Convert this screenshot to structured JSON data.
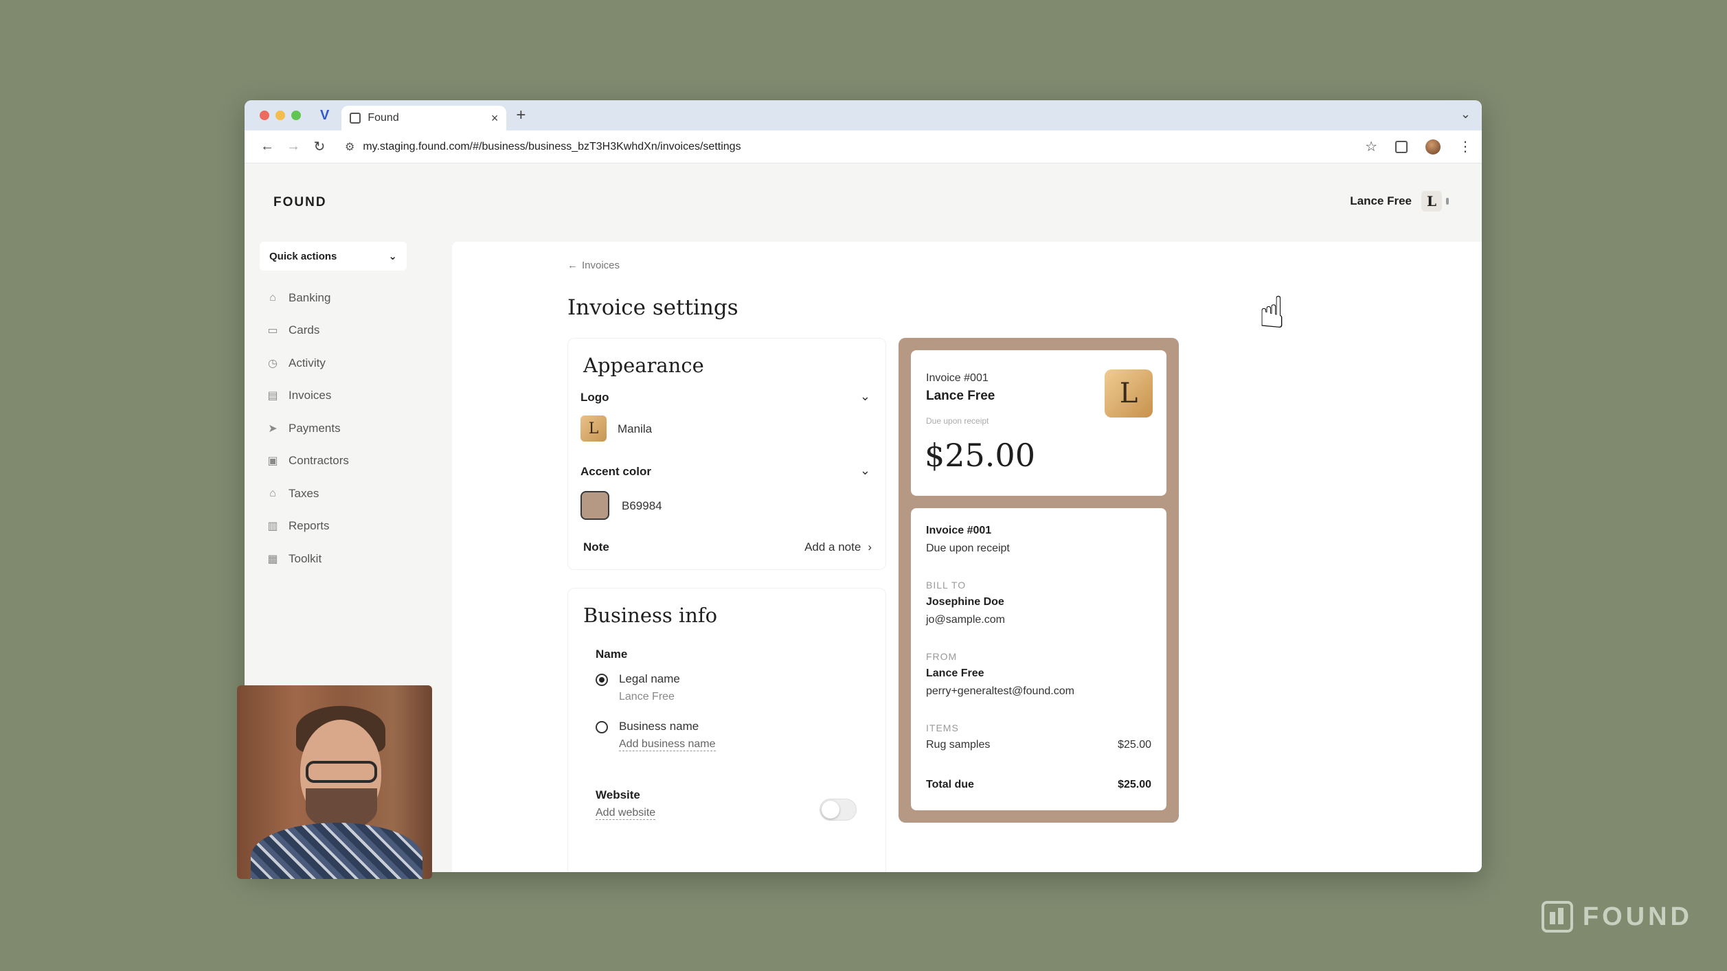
{
  "browser": {
    "tab_title": "Found",
    "url": "my.staging.found.com/#/business/business_bzT3H3KwhdXn/invoices/settings"
  },
  "app": {
    "brand": "FOUND",
    "user_name": "Lance Free",
    "user_initial": "L",
    "quick_actions": "Quick actions",
    "sidebar": [
      {
        "label": "Banking",
        "icon": "bank-icon"
      },
      {
        "label": "Cards",
        "icon": "card-icon"
      },
      {
        "label": "Activity",
        "icon": "clock-icon"
      },
      {
        "label": "Invoices",
        "icon": "invoice-icon"
      },
      {
        "label": "Payments",
        "icon": "send-icon"
      },
      {
        "label": "Contractors",
        "icon": "contractors-icon"
      },
      {
        "label": "Taxes",
        "icon": "taxes-icon"
      },
      {
        "label": "Reports",
        "icon": "chart-icon"
      },
      {
        "label": "Toolkit",
        "icon": "toolkit-icon"
      }
    ]
  },
  "page": {
    "back_label": "Invoices",
    "title": "Invoice settings"
  },
  "appearance": {
    "title": "Appearance",
    "logo_label": "Logo",
    "logo_value": "Manila",
    "logo_initial": "L",
    "accent_label": "Accent color",
    "accent_value": "B69984",
    "accent_color": "#b69984",
    "note_label": "Note",
    "note_link": "Add a note"
  },
  "business_info": {
    "title": "Business info",
    "name_label": "Name",
    "legal_name_label": "Legal name",
    "legal_name_value": "Lance Free",
    "business_name_label": "Business name",
    "business_name_link": "Add business name",
    "website_label": "Website",
    "website_link": "Add website"
  },
  "preview": {
    "top": {
      "invoice_no": "Invoice #001",
      "name": "Lance Free",
      "due": "Due upon receipt",
      "amount": "$25.00",
      "initial": "L"
    },
    "bottom": {
      "invoice_no": "Invoice #001",
      "due": "Due upon receipt",
      "bill_to_caption": "BILL TO",
      "bill_to_name": "Josephine Doe",
      "bill_to_email": "jo@sample.com",
      "from_caption": "FROM",
      "from_name": "Lance Free",
      "from_email": "perry+generaltest@found.com",
      "items_caption": "ITEMS",
      "item_name": "Rug samples",
      "item_price": "$25.00",
      "total_label": "Total due",
      "total_value": "$25.00"
    }
  },
  "watermark": "FOUND"
}
